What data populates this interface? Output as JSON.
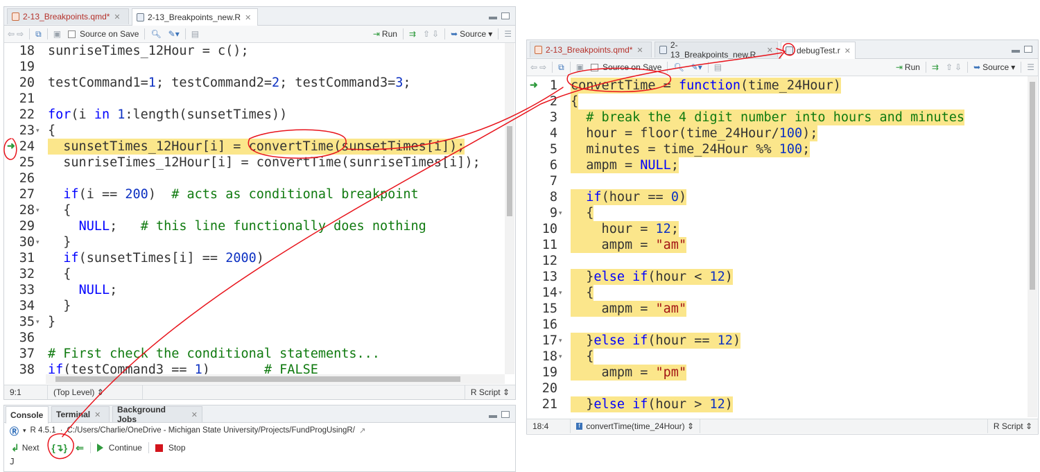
{
  "left_editor": {
    "tabs": [
      {
        "label": "2-13_Breakpoints.qmd*",
        "modified": true
      },
      {
        "label": "2-13_Breakpoints_new.R",
        "modified": false
      }
    ],
    "toolbar": {
      "source_on_save": "Source on Save",
      "run": "Run",
      "source": "Source"
    },
    "lines": [
      {
        "n": "18",
        "code": "sunriseTimes_12Hour = c();"
      },
      {
        "n": "19",
        "code": ""
      },
      {
        "n": "20",
        "code": "testCommand1=1; testCommand2=2; testCommand3=3;"
      },
      {
        "n": "21",
        "code": ""
      },
      {
        "n": "22",
        "code": "for(i in 1:length(sunsetTimes))"
      },
      {
        "n": "23",
        "code": "{"
      },
      {
        "n": "24",
        "code": "  sunsetTimes_12Hour[i] = convertTime(sunsetTimes[i]);"
      },
      {
        "n": "25",
        "code": "  sunriseTimes_12Hour[i] = convertTime(sunriseTimes[i]);"
      },
      {
        "n": "26",
        "code": ""
      },
      {
        "n": "27",
        "code": "  if(i == 200)  # acts as conditional breakpoint"
      },
      {
        "n": "28",
        "code": "  {"
      },
      {
        "n": "29",
        "code": "    NULL;   # this line functionally does nothing"
      },
      {
        "n": "30",
        "code": "  }"
      },
      {
        "n": "31",
        "code": "  if(sunsetTimes[i] == 2000)"
      },
      {
        "n": "32",
        "code": "  {"
      },
      {
        "n": "33",
        "code": "    NULL;"
      },
      {
        "n": "34",
        "code": "  }"
      },
      {
        "n": "35",
        "code": "}"
      },
      {
        "n": "36",
        "code": ""
      },
      {
        "n": "37",
        "code": "# First check the conditional statements..."
      },
      {
        "n": "38",
        "code": "if(testCommand3 == 1)       # FALSE"
      }
    ],
    "status": {
      "position": "9:1",
      "scope": "(Top Level)",
      "filetype": "R Script"
    }
  },
  "console": {
    "tabs": [
      "Console",
      "Terminal",
      "Background Jobs"
    ],
    "version": "R 4.5.1",
    "path": "C:/Users/Charlie/OneDrive - Michigan State University/Projects/FundProgUsingR/",
    "buttons": {
      "next": "Next",
      "continue": "Continue",
      "stop": "Stop"
    },
    "prompt": "J"
  },
  "right_editor": {
    "tabs": [
      {
        "label": "2-13_Breakpoints.qmd*",
        "modified": true
      },
      {
        "label": "2-13_Breakpoints_new.R",
        "modified": false
      },
      {
        "label": "debugTest.r",
        "modified": false
      }
    ],
    "toolbar": {
      "source_on_save": "Source on Save",
      "run": "Run",
      "source": "Source"
    },
    "lines": [
      {
        "n": "1",
        "code": "convertTime = function(time_24Hour)"
      },
      {
        "n": "2",
        "code": "{"
      },
      {
        "n": "3",
        "code": "  # break the 4 digit number into hours and minutes"
      },
      {
        "n": "4",
        "code": "  hour = floor(time_24Hour/100);"
      },
      {
        "n": "5",
        "code": "  minutes = time_24Hour %% 100;"
      },
      {
        "n": "6",
        "code": "  ampm = NULL;"
      },
      {
        "n": "7",
        "code": ""
      },
      {
        "n": "8",
        "code": "  if(hour == 0)"
      },
      {
        "n": "9",
        "code": "  {"
      },
      {
        "n": "10",
        "code": "    hour = 12;"
      },
      {
        "n": "11",
        "code": "    ampm = \"am\""
      },
      {
        "n": "12",
        "code": ""
      },
      {
        "n": "13",
        "code": "  }else if(hour < 12)"
      },
      {
        "n": "14",
        "code": "  {"
      },
      {
        "n": "15",
        "code": "    ampm = \"am\""
      },
      {
        "n": "16",
        "code": ""
      },
      {
        "n": "17",
        "code": "  }else if(hour == 12)"
      },
      {
        "n": "18",
        "code": "  {"
      },
      {
        "n": "19",
        "code": "    ampm = \"pm\""
      },
      {
        "n": "20",
        "code": ""
      },
      {
        "n": "21",
        "code": "  }else if(hour > 12)"
      }
    ],
    "status": {
      "position": "18:4",
      "scope": "convertTime(time_24Hour)",
      "filetype": "R Script"
    }
  },
  "colors": {
    "highlight": "#fbe68b",
    "annotation": "#e8141c",
    "keyword": "#0000ff",
    "number": "#0d31c2",
    "string": "#a31515",
    "comment": "#0f7a0f"
  },
  "icons": [
    "back-arrow-icon",
    "forward-arrow-icon",
    "show-in-window-icon",
    "save-icon",
    "search-icon",
    "magic-wand-icon",
    "outline-icon",
    "run-icon",
    "rerun-icon",
    "up-icon",
    "down-icon",
    "source-icon",
    "menu-icon",
    "debug-arrow-icon",
    "r-logo-icon",
    "step-into-icon",
    "step-out-icon"
  ]
}
